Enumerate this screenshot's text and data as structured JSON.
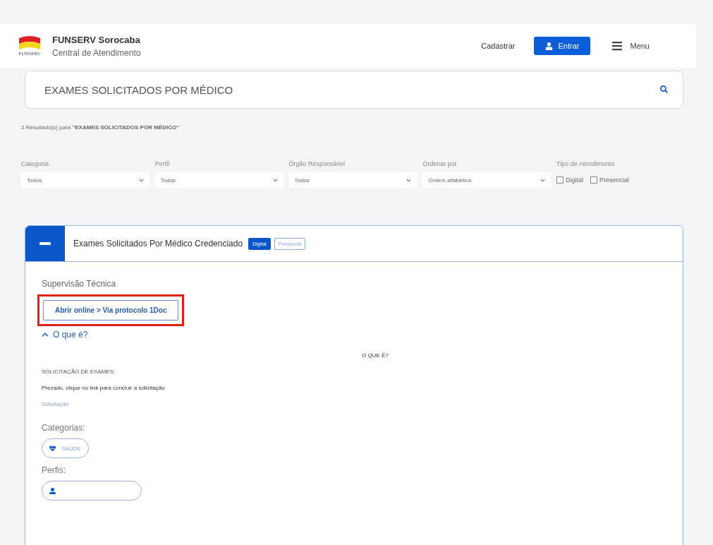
{
  "header": {
    "brand": "FUNSERV Sorocaba",
    "subtitle": "Central de Atendimento",
    "logo_text": "FUNSERV",
    "register": "Cadastrar",
    "login": "Entrar",
    "menu": "Menu"
  },
  "search": {
    "value": "EXAMES SOLICITADOS POR MÉDICO"
  },
  "results": {
    "text": "2 Resultado(s) para **\"EXAMES SOLICITADOS POR MÉDICO\"**"
  },
  "filters": [
    {
      "label": "Categoria",
      "value": "Todos"
    },
    {
      "label": "Perfil",
      "value": "Todos"
    },
    {
      "label": "Órgão Responsável",
      "value": "Todos"
    },
    {
      "label": "Ordenar por",
      "value": "Ordem alfabética"
    }
  ],
  "service_type": {
    "label": "Tipo de Atendimento",
    "options": [
      {
        "label": "Digital",
        "checked": false
      },
      {
        "label": "Presencial",
        "checked": false
      }
    ]
  },
  "card": {
    "title": "Exames Solicitados Por Médico Credenciado",
    "expanded": true,
    "badges": [
      {
        "label": "Digital",
        "kind": "filled"
      },
      {
        "label": "Presencial",
        "kind": "outline"
      }
    ],
    "department": "Supervisão Técnica",
    "action": "Abrir online > Via protocolo 1Doc",
    "highlighted": true,
    "toggle": {
      "label": "O que é?",
      "expanded": true
    },
    "section_title": "O QUE É?",
    "heading": "SOLICITAÇÃO DE EXAMES:",
    "text": "Prezado, clique no link para concluir a solicitação",
    "link": "Solicitação",
    "categories_label": "Categorias:",
    "categories": [
      "SAÚDE"
    ],
    "profiles_label": "Perfis:"
  }
}
